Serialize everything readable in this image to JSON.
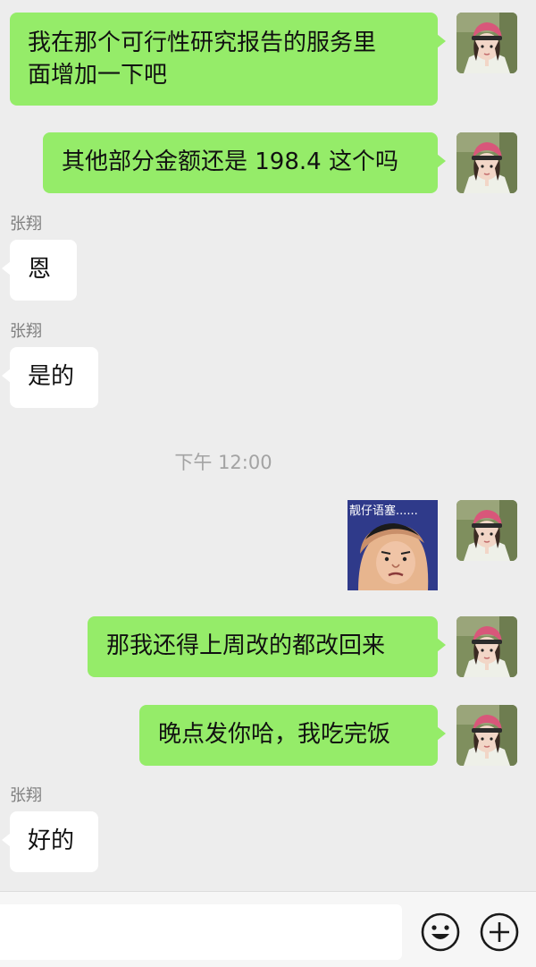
{
  "contact": {
    "name": "张翔"
  },
  "messages": {
    "m1": {
      "line1": "我在那个可行性研究报告的服务里",
      "line2": "面增加一下吧"
    },
    "m2": {
      "text": "其他部分金额还是 198.4 这个吗"
    },
    "m3": {
      "sender": "张翔",
      "text": "恩"
    },
    "m4": {
      "sender": "张翔",
      "text": "是的"
    },
    "timestamp": "下午 12:00",
    "m5": {
      "sticker_caption": "靓仔语塞......"
    },
    "m6": {
      "text": "那我还得上周改的都改回来"
    },
    "m7": {
      "text": "晚点发你哈，我吃完饭"
    },
    "m8": {
      "sender": "张翔",
      "text": "好的"
    }
  },
  "input_bar": {
    "placeholder": "",
    "value": "",
    "icons": [
      "emoji-icon",
      "plus-icon"
    ]
  },
  "colors": {
    "background": "#ededed",
    "outgoing_bubble": "#95ec69",
    "incoming_bubble": "#ffffff",
    "sender_name": "#7f7f7f",
    "timestamp": "#a3a3a3"
  }
}
